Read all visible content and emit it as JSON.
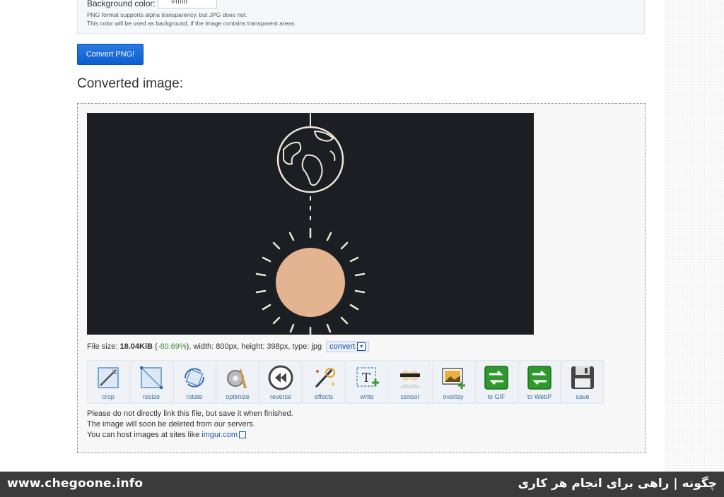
{
  "options": {
    "bg_label": "Background color:",
    "bg_value": "#ffffff",
    "note_line1": "PNG format supports alpha transparency, but JPG does not.",
    "note_line2": "This color will be used as background, if the image contains transparent areas."
  },
  "convert_button": "Convert PNG!",
  "section_title": "Converted image:",
  "file_info": {
    "prefix": "File size: ",
    "size": "18.04KiB",
    "open": " (",
    "percent": "-80.69%",
    "rest": "), width: 800px, height: 398px, type: jpg",
    "convert_label": "convert"
  },
  "tools": [
    {
      "label": "crop",
      "icon": "crop-icon"
    },
    {
      "label": "resize",
      "icon": "resize-icon"
    },
    {
      "label": "rotate",
      "icon": "rotate-icon"
    },
    {
      "label": "optimize",
      "icon": "optimize-icon"
    },
    {
      "label": "reverse",
      "icon": "reverse-icon"
    },
    {
      "label": "effects",
      "icon": "effects-icon"
    },
    {
      "label": "write",
      "icon": "write-icon"
    },
    {
      "label": "censor",
      "icon": "censor-icon"
    },
    {
      "label": "overlay",
      "icon": "overlay-icon"
    },
    {
      "label": "to GIF",
      "icon": "to-gif-icon"
    },
    {
      "label": "to WebP",
      "icon": "to-webp-icon"
    },
    {
      "label": "save",
      "icon": "save-icon"
    }
  ],
  "footnotes": {
    "line1": "Please do not directly link this file, but save it when finished.",
    "line2": "The image will soon be deleted from our servers.",
    "line3_prefix": "You can host images at sites like ",
    "line3_link": "imgur.com"
  },
  "bottom_bar": {
    "left": "www.chegoone.info",
    "right": "چگونه | راهی برای انجام هر کاری"
  },
  "colors": {
    "accent": "#0a5fcf",
    "image_bg": "#1b1f24",
    "sun": "#e3b48f",
    "chalk": "#efe7d6",
    "bar": "#3b3b3b"
  }
}
